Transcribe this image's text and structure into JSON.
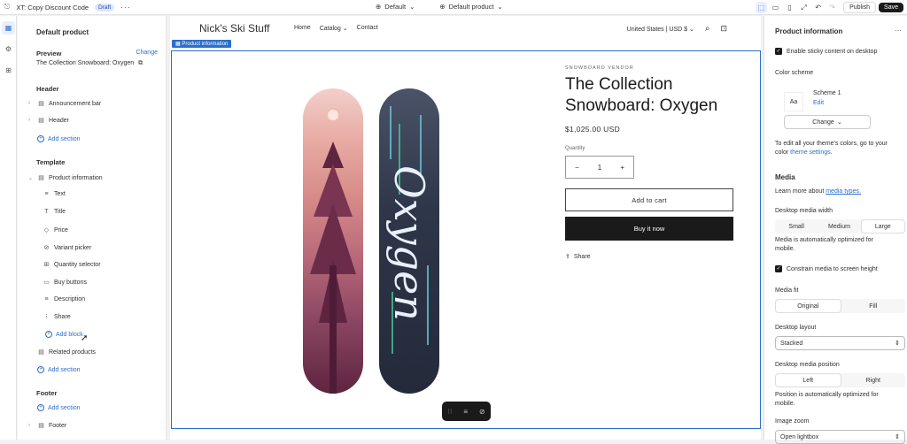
{
  "topbar": {
    "theme_name": "XT: Copy Discount Code",
    "status_badge": "Draft",
    "more": "···",
    "device_select": "Default",
    "template_select": "Default product",
    "publish_label": "Publish",
    "save_label": "Save"
  },
  "left_panel": {
    "title": "Default product",
    "preview_label": "Preview",
    "change_label": "Change",
    "preview_value": "The Collection Snowboard: Oxygen",
    "header_section": "Header",
    "header_items": [
      "Announcement bar",
      "Header"
    ],
    "add_section": "Add section",
    "template_section": "Template",
    "product_information": "Product information",
    "blocks": [
      "Text",
      "Title",
      "Price",
      "Variant picker",
      "Quantity selector",
      "Buy buttons",
      "Description",
      "Share"
    ],
    "add_block": "Add block",
    "related_products": "Related products",
    "footer_section": "Footer",
    "footer_item": "Footer"
  },
  "store": {
    "name": "Nick's Ski Stuff",
    "nav": [
      "Home",
      "Catalog",
      "Contact"
    ],
    "locale": "United States",
    "currency": "USD $",
    "selection_tag": "Product information"
  },
  "product": {
    "vendor": "SNOWBOARD VENDOR",
    "title": "The Collection Snowboard: Oxygen",
    "price": "$1,025.00 USD",
    "quantity_label": "Quantity",
    "quantity_value": "1",
    "add_to_cart": "Add to cart",
    "buy_now": "Buy it now",
    "share": "Share",
    "board_script": "Oxygen"
  },
  "right_panel": {
    "title": "Product information",
    "sticky_label": "Enable sticky content on desktop",
    "color_scheme_label": "Color scheme",
    "scheme_name": "Scheme 1",
    "scheme_edit": "Edit",
    "scheme_swatch": "Aa",
    "change_label": "Change",
    "colors_hint_1": "To edit all your theme's colors, go to your",
    "colors_hint_2": "color",
    "colors_hint_link": "theme settings",
    "media_heading": "Media",
    "media_learn": "Learn more about",
    "media_learn_link": "media types.",
    "desktop_media_width": "Desktop media width",
    "width_options": [
      "Small",
      "Medium",
      "Large"
    ],
    "width_selected": "Large",
    "media_optimized_1": "Media is automatically optimized for",
    "media_optimized_2": "mobile.",
    "constrain_label": "Constrain media to screen height",
    "media_fit": "Media fit",
    "fit_options": [
      "Original",
      "Fill"
    ],
    "fit_selected": "Original",
    "desktop_layout": "Desktop layout",
    "layout_value": "Stacked",
    "desktop_media_position": "Desktop media position",
    "position_options": [
      "Left",
      "Right"
    ],
    "position_selected": "Left",
    "position_hint_1": "Position is automatically optimized for",
    "position_hint_2": "mobile.",
    "image_zoom": "Image zoom",
    "zoom_value": "Open lightbox"
  }
}
